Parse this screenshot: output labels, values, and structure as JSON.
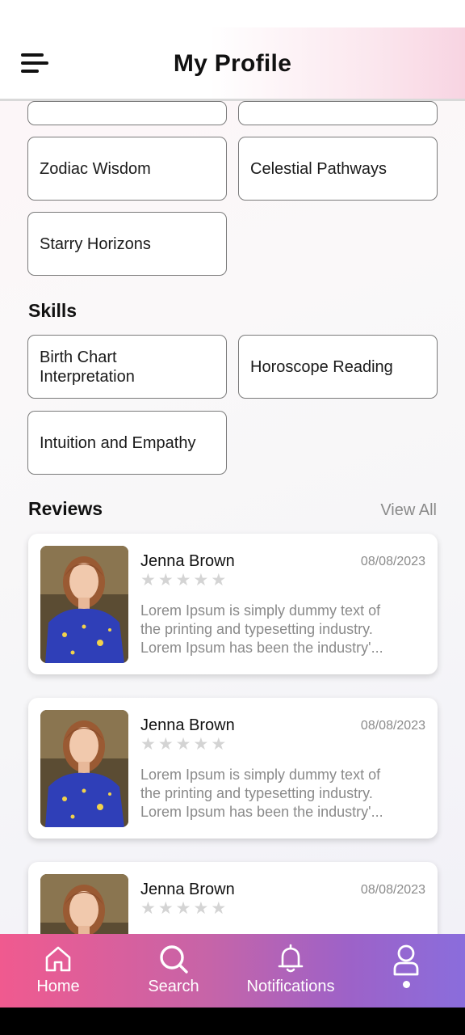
{
  "header": {
    "title": "My Profile"
  },
  "specialties": [
    {
      "label": ""
    },
    {
      "label": ""
    },
    {
      "label": "Zodiac Wisdom"
    },
    {
      "label": "Celestial Pathways"
    },
    {
      "label": "Starry Horizons"
    }
  ],
  "skills_section": {
    "title": "Skills",
    "items": [
      {
        "label": "Birth Chart Interpretation"
      },
      {
        "label": "Horoscope Reading"
      },
      {
        "label": "Intuition and Empathy"
      }
    ]
  },
  "reviews_section": {
    "title": "Reviews",
    "view_all_label": "View All",
    "items": [
      {
        "name": "Jenna Brown",
        "date": "08/08/2023",
        "rating": 0,
        "text_lines": [
          "Lorem Ipsum is simply dummy text of",
          "the printing and typesetting industry.",
          "Lorem Ipsum has been the industry'..."
        ]
      },
      {
        "name": "Jenna Brown",
        "date": "08/08/2023",
        "rating": 0,
        "text_lines": [
          "Lorem Ipsum is simply dummy text of",
          "the printing and typesetting industry.",
          "Lorem Ipsum has been the industry'..."
        ]
      },
      {
        "name": "Jenna Brown",
        "date": "08/08/2023",
        "rating": 0,
        "text_lines": [
          "",
          "",
          ""
        ]
      }
    ]
  },
  "bottom_nav": {
    "items": [
      {
        "label": "Home",
        "icon": "home-icon"
      },
      {
        "label": "Search",
        "icon": "search-icon"
      },
      {
        "label": "Notifications",
        "icon": "bell-icon"
      },
      {
        "label": "",
        "icon": "user-icon",
        "active": true
      }
    ]
  },
  "colors": {
    "nav_gradient_start": "#f05a8f",
    "nav_gradient_end": "#8a6ddc",
    "chip_border": "#7a7a7a",
    "muted_text": "#8a8a8a",
    "star_empty": "#d4d4d4"
  }
}
